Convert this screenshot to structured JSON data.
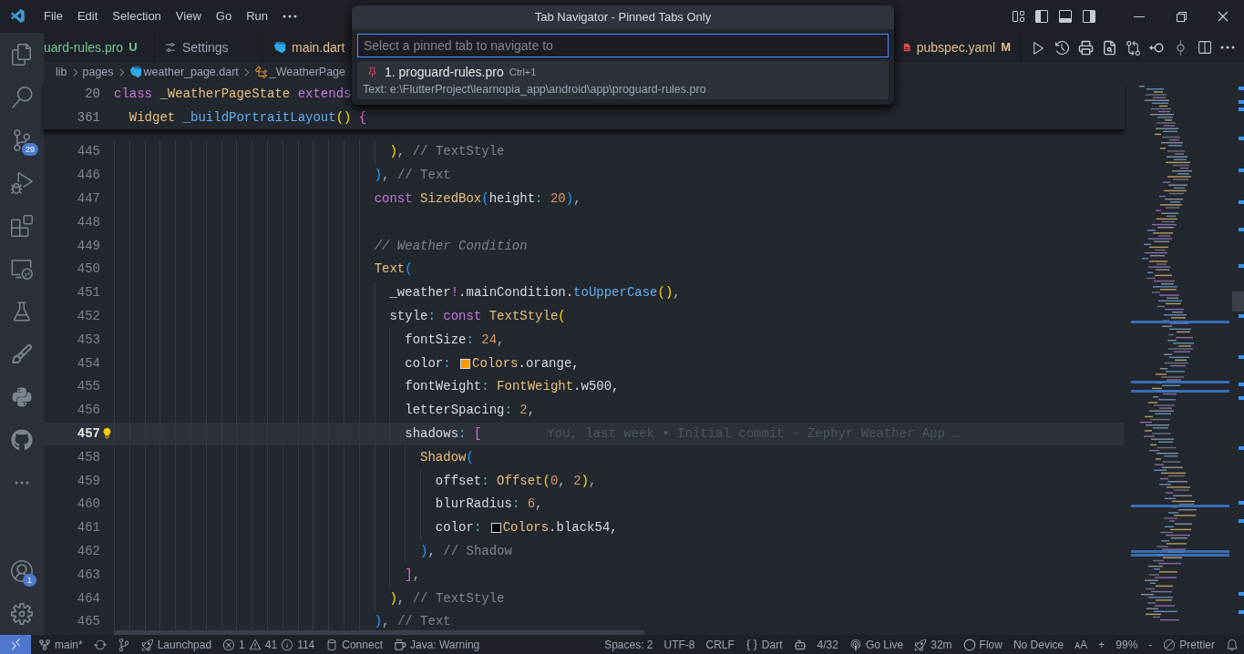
{
  "title_bar": {
    "menu": [
      "File",
      "Edit",
      "Selection",
      "View",
      "Go",
      "Run"
    ]
  },
  "activity_bar": {
    "source_control_badge": "29",
    "accounts_badge": "1"
  },
  "tabs": [
    {
      "label": "uard-rules.pro",
      "status": "U",
      "color": "#73c991",
      "kind": "pinned",
      "selected": false
    },
    {
      "label": "Settings",
      "kind": "settings",
      "selected": false
    },
    {
      "label": "main.dart",
      "color": "#e2c08d",
      "kind": "dart",
      "selected": false
    },
    {
      "label": "pubspec.yaml",
      "status": "M",
      "color": "#e2c08d",
      "kind": "yaml",
      "selected": false
    }
  ],
  "breadcrumbs": [
    {
      "label": "lib",
      "kind": "folder"
    },
    {
      "label": "pages",
      "kind": "folder"
    },
    {
      "label": "weather_page.dart",
      "kind": "dart"
    },
    {
      "label": "_WeatherPage",
      "kind": "class"
    }
  ],
  "sticky_lines": [
    {
      "number": "20",
      "tokens": [
        {
          "text": "class ",
          "kind": "keyword"
        },
        {
          "text": "_WeatherPageState",
          "kind": "class"
        },
        {
          "text": " extends",
          "kind": "keyword"
        }
      ]
    },
    {
      "number": "361",
      "tokens": [
        {
          "text": "  Widget ",
          "kind": "class"
        },
        {
          "text": "_buildPortraitLayout",
          "kind": "method"
        },
        {
          "text": "()",
          "kind": "b1"
        },
        {
          "text": " {",
          "kind": "b2"
        }
      ]
    }
  ],
  "lines": [
    {
      "number": "445",
      "current": false,
      "tokens": [
        {
          "text": "                                    )",
          "kind": "b1"
        },
        {
          "text": ", ",
          "kind": "punct"
        },
        {
          "text": "// TextStyle",
          "kind": "label"
        }
      ]
    },
    {
      "number": "446",
      "current": false,
      "tokens": [
        {
          "text": "                                  )",
          "kind": "b3"
        },
        {
          "text": ", ",
          "kind": "punct"
        },
        {
          "text": "// Text",
          "kind": "label"
        }
      ]
    },
    {
      "number": "447",
      "current": false,
      "tokens": [
        {
          "text": "                                  const ",
          "kind": "keyword"
        },
        {
          "text": "SizedBox",
          "kind": "class"
        },
        {
          "text": "(",
          "kind": "b3"
        },
        {
          "text": "height",
          "kind": "plain"
        },
        {
          "text": ":",
          "kind": "colon"
        },
        {
          "text": " 20",
          "kind": "number"
        },
        {
          "text": ")",
          "kind": "b3"
        },
        {
          "text": ",",
          "kind": "punct"
        }
      ]
    },
    {
      "number": "448",
      "current": false
    },
    {
      "number": "449",
      "current": false,
      "tokens": [
        {
          "text": "                                  // Weather Condition",
          "kind": "comment"
        }
      ]
    },
    {
      "number": "450",
      "current": false,
      "tokens": [
        {
          "text": "                                  Text",
          "kind": "class"
        },
        {
          "text": "(",
          "kind": "b3"
        }
      ]
    },
    {
      "number": "451",
      "current": false,
      "tokens": [
        {
          "text": "                                    _weather",
          "kind": "plain"
        },
        {
          "text": "!",
          "kind": "keyword"
        },
        {
          "text": ".mainCondition.",
          "kind": "plain"
        },
        {
          "text": "toUpperCase",
          "kind": "method"
        },
        {
          "text": "()",
          "kind": "b1"
        },
        {
          "text": ",",
          "kind": "punct"
        }
      ]
    },
    {
      "number": "452",
      "current": false,
      "tokens": [
        {
          "text": "                                    style",
          "kind": "plain"
        },
        {
          "text": ":",
          "kind": "colon"
        },
        {
          "text": " const ",
          "kind": "keyword"
        },
        {
          "text": "TextStyle",
          "kind": "class"
        },
        {
          "text": "(",
          "kind": "b1"
        }
      ]
    },
    {
      "number": "453",
      "current": false,
      "tokens": [
        {
          "text": "                                      fontSize",
          "kind": "plain"
        },
        {
          "text": ":",
          "kind": "colon"
        },
        {
          "text": " 24",
          "kind": "number"
        },
        {
          "text": ",",
          "kind": "punct"
        }
      ]
    },
    {
      "number": "454",
      "current": false,
      "tokens": [
        {
          "text": "                                      color",
          "kind": "plain"
        },
        {
          "text": ": ",
          "kind": "colon"
        },
        {
          "kind": "swatch",
          "color": "#ff9800"
        },
        {
          "text": "Colors",
          "kind": "class"
        },
        {
          "text": ".orange,",
          "kind": "plain"
        }
      ]
    },
    {
      "number": "455",
      "current": false,
      "tokens": [
        {
          "text": "                                      fontWeight",
          "kind": "plain"
        },
        {
          "text": ": ",
          "kind": "colon"
        },
        {
          "text": "FontWeight",
          "kind": "class"
        },
        {
          "text": ".w500,",
          "kind": "plain"
        }
      ]
    },
    {
      "number": "456",
      "current": false,
      "tokens": [
        {
          "text": "                                      letterSpacing",
          "kind": "plain"
        },
        {
          "text": ":",
          "kind": "colon"
        },
        {
          "text": " 2",
          "kind": "number"
        },
        {
          "text": ",",
          "kind": "punct"
        }
      ]
    },
    {
      "number": "457",
      "current": true,
      "blame": "You, last week • Initial commit - Zephyr Weather App …",
      "tokens": [
        {
          "text": "                                      shadows",
          "kind": "plain"
        },
        {
          "text": ": ",
          "kind": "colon"
        },
        {
          "text": "[",
          "kind": "b2"
        }
      ]
    },
    {
      "number": "458",
      "current": false,
      "tokens": [
        {
          "text": "                                        Shadow",
          "kind": "class"
        },
        {
          "text": "(",
          "kind": "b3"
        }
      ]
    },
    {
      "number": "459",
      "current": false,
      "tokens": [
        {
          "text": "                                          offset",
          "kind": "plain"
        },
        {
          "text": ": ",
          "kind": "colon"
        },
        {
          "text": "Offset",
          "kind": "class"
        },
        {
          "text": "(",
          "kind": "b1"
        },
        {
          "text": "0",
          "kind": "number"
        },
        {
          "text": ", ",
          "kind": "punct"
        },
        {
          "text": "2",
          "kind": "number"
        },
        {
          "text": ")",
          "kind": "b1"
        },
        {
          "text": ",",
          "kind": "punct"
        }
      ]
    },
    {
      "number": "460",
      "current": false,
      "tokens": [
        {
          "text": "                                          blurRadius",
          "kind": "plain"
        },
        {
          "text": ":",
          "kind": "colon"
        },
        {
          "text": " 6",
          "kind": "number"
        },
        {
          "text": ",",
          "kind": "punct"
        }
      ]
    },
    {
      "number": "461",
      "current": false,
      "tokens": [
        {
          "text": "                                          color",
          "kind": "plain"
        },
        {
          "text": ": ",
          "kind": "colon"
        },
        {
          "kind": "swatch",
          "color": "#000000"
        },
        {
          "text": "Colors",
          "kind": "class"
        },
        {
          "text": ".black54,",
          "kind": "plain"
        }
      ]
    },
    {
      "number": "462",
      "current": false,
      "tokens": [
        {
          "text": "                                        )",
          "kind": "b3"
        },
        {
          "text": ", ",
          "kind": "punct"
        },
        {
          "text": "// Shadow",
          "kind": "label"
        }
      ]
    },
    {
      "number": "463",
      "current": false,
      "tokens": [
        {
          "text": "                                      ]",
          "kind": "b2"
        },
        {
          "text": ",",
          "kind": "punct"
        }
      ]
    },
    {
      "number": "464",
      "current": false,
      "tokens": [
        {
          "text": "                                    )",
          "kind": "b1"
        },
        {
          "text": ", ",
          "kind": "punct"
        },
        {
          "text": "// TextStyle",
          "kind": "label"
        }
      ]
    },
    {
      "number": "465",
      "current": false,
      "tokens": [
        {
          "text": "                                  )",
          "kind": "b3"
        },
        {
          "text": ", ",
          "kind": "punct"
        },
        {
          "text": "// Text",
          "kind": "label"
        }
      ]
    }
  ],
  "quick_pick": {
    "title": "Tab Navigator - Pinned Tabs Only",
    "placeholder": "Select a pinned tab to navigate to",
    "items": [
      {
        "label": "1. proguard-rules.pro",
        "keybinding": "Ctrl+1",
        "detail": "Text: e:\\FlutterProject\\learnopia_app\\android\\app\\proguard-rules.pro",
        "selected": true
      }
    ]
  },
  "status_bar": {
    "left": [
      {
        "kind": "branch",
        "text": "main*"
      },
      {
        "kind": "sync"
      },
      {
        "kind": "graph"
      },
      {
        "kind": "launchpad",
        "text": "Launchpad"
      },
      {
        "kind": "problems",
        "errors": "1",
        "warnings": "41",
        "infos": "114"
      },
      {
        "kind": "connect",
        "text": "Connect"
      },
      {
        "kind": "java",
        "text": "Java: Warning"
      }
    ],
    "right": [
      {
        "kind": "text",
        "text": "Spaces: 2"
      },
      {
        "kind": "text",
        "text": "UTF-8"
      },
      {
        "kind": "text",
        "text": "CRLF"
      },
      {
        "kind": "language",
        "text": "Dart"
      },
      {
        "kind": "copilot"
      },
      {
        "kind": "text",
        "text": "4/32"
      },
      {
        "kind": "golive",
        "text": "Go Live"
      },
      {
        "kind": "rocket",
        "text": "32m"
      },
      {
        "kind": "flow",
        "text": "Flow"
      },
      {
        "kind": "text",
        "text": "No Device"
      },
      {
        "kind": "text",
        "text": "ᴀA"
      },
      {
        "kind": "text",
        "text": "+"
      },
      {
        "kind": "text",
        "text": "99%"
      },
      {
        "kind": "text",
        "text": "-"
      },
      {
        "kind": "prettier",
        "text": "Prettier"
      },
      {
        "kind": "bell"
      }
    ]
  }
}
